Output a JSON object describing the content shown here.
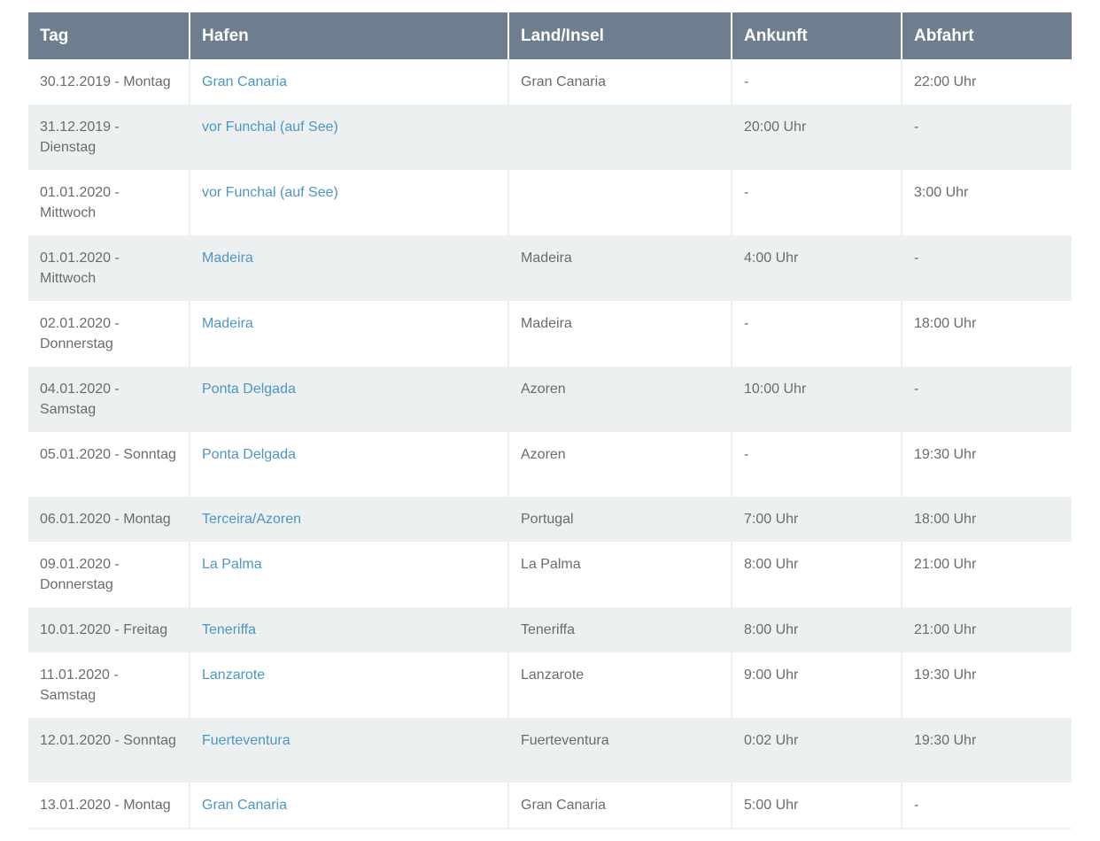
{
  "schedule": {
    "columns": [
      "Tag",
      "Hafen",
      "Land/Insel",
      "Ankunft",
      "Abfahrt"
    ],
    "rows": [
      {
        "tag": "30.12.2019 - Montag",
        "hafen": "Gran Canaria",
        "land": "Gran Canaria",
        "ankunft": "-",
        "abfahrt": "22:00 Uhr"
      },
      {
        "tag": "31.12.2019 - Dienstag",
        "hafen": "vor Funchal (auf See)",
        "land": "",
        "ankunft": "20:00 Uhr",
        "abfahrt": "-"
      },
      {
        "tag": "01.01.2020 - Mittwoch",
        "hafen": "vor Funchal (auf See)",
        "land": "",
        "ankunft": "-",
        "abfahrt": "3:00 Uhr"
      },
      {
        "tag": "01.01.2020 - Mittwoch",
        "hafen": "Madeira",
        "land": "Madeira",
        "ankunft": "4:00 Uhr",
        "abfahrt": "-"
      },
      {
        "tag": "02.01.2020 - Donnerstag",
        "hafen": "Madeira",
        "land": "Madeira",
        "ankunft": "-",
        "abfahrt": "18:00 Uhr"
      },
      {
        "tag": "04.01.2020 - Samstag",
        "hafen": "Ponta Delgada",
        "land": "Azoren",
        "ankunft": "10:00 Uhr",
        "abfahrt": "-"
      },
      {
        "tag": "05.01.2020 - Sonntag",
        "hafen": "Ponta Delgada",
        "land": "Azoren",
        "ankunft": "-",
        "abfahrt": "19:30 Uhr"
      },
      {
        "tag": "06.01.2020 - Montag",
        "hafen": "Terceira/Azoren",
        "land": "Portugal",
        "ankunft": "7:00 Uhr",
        "abfahrt": "18:00 Uhr"
      },
      {
        "tag": "09.01.2020 - Donnerstag",
        "hafen": "La Palma",
        "land": "La Palma",
        "ankunft": "8:00 Uhr",
        "abfahrt": "21:00 Uhr"
      },
      {
        "tag": "10.01.2020 - Freitag",
        "hafen": "Teneriffa",
        "land": "Teneriffa",
        "ankunft": "8:00 Uhr",
        "abfahrt": "21:00 Uhr"
      },
      {
        "tag": "11.01.2020 - Samstag",
        "hafen": "Lanzarote",
        "land": "Lanzarote",
        "ankunft": "9:00 Uhr",
        "abfahrt": "19:30 Uhr"
      },
      {
        "tag": "12.01.2020 - Sonntag",
        "hafen": "Fuerteventura",
        "land": "Fuerteventura",
        "ankunft": "0:02 Uhr",
        "abfahrt": "19:30 Uhr"
      },
      {
        "tag": "13.01.2020 - Montag",
        "hafen": "Gran Canaria",
        "land": "Gran Canaria",
        "ankunft": "5:00 Uhr",
        "abfahrt": "-"
      }
    ]
  },
  "colors": {
    "header_bg": "#6e7e8e",
    "stripe_bg": "#edf0f1",
    "link": "#4b96c4",
    "text": "#6b6b6b"
  }
}
